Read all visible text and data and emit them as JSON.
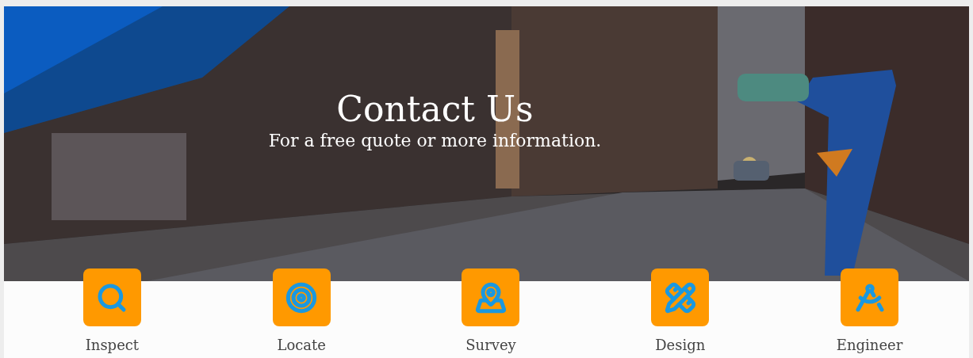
{
  "hero": {
    "title": "Contact Us",
    "subtitle": "For a free quote or more information."
  },
  "services": [
    {
      "label": "Inspect",
      "kind": "search"
    },
    {
      "label": "Locate",
      "kind": "target"
    },
    {
      "label": "Survey",
      "kind": "map"
    },
    {
      "label": "Design",
      "kind": "pencil-ruler"
    },
    {
      "label": "Engineer",
      "kind": "compass"
    }
  ]
}
